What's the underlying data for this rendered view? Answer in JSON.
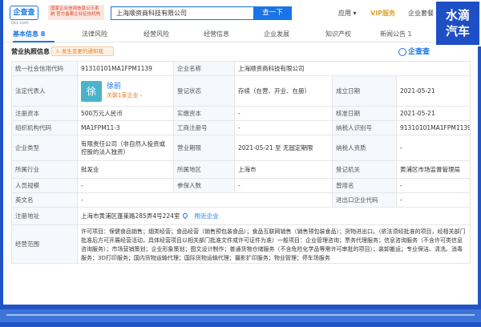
{
  "header": {
    "logo": "企查查",
    "logo_sub": "Qcc.com",
    "promo": "国家企业信用信息公示系统 官方备案企业征信机构",
    "search_value": "上海顺资商科技有限公司",
    "search_button": "查一下",
    "links": [
      "应用 ▾",
      "VIP服务",
      "企业套餐"
    ]
  },
  "corner_logo": [
    "水滴",
    "汽车"
  ],
  "tabs": [
    "基本信息 8",
    "法律风险",
    "经营风险",
    "经营信息",
    "企业发展",
    "知识产权",
    "新闻公告 1"
  ],
  "section": {
    "title": "营业执照信息",
    "warning": "发生变更的通知我",
    "mark": "企查查"
  },
  "table": {
    "credit_code_label": "统一社会信用代码",
    "credit_code": "91310101MA1FPM1139",
    "company_name_label": "企业名称",
    "company_name": "上海顺资商科技有限公司",
    "legal_rep_label": "法定代表人",
    "legal_rep_avatar": "徐",
    "legal_rep_name": "徐前",
    "legal_rep_count": "关联1家企业 ›",
    "reg_status_label": "登记状态",
    "reg_status": "存续（在营、开业、在册）",
    "est_date_label": "成立日期",
    "est_date": "2021-05-21",
    "reg_capital_label": "注册资本",
    "reg_capital": "500万元人民币",
    "paid_capital_label": "实缴资本",
    "paid_capital": "-",
    "approval_date_label": "核准日期",
    "approval_date": "2021-05-21",
    "org_code_label": "组织机构代码",
    "org_code": "MA1FPM11-3",
    "biz_reg_no_label": "工商注册号",
    "biz_reg_no": "-",
    "taxpayer_id_label": "纳税人识别号",
    "taxpayer_id": "91310101MA1FPM1139",
    "company_type_label": "企业类型",
    "company_type": "有限责任公司（非自然人投资或控股的法人独资）",
    "biz_term_label": "营业期限",
    "biz_term": "2021-05-21 至 无固定期限",
    "taxpayer_qual_label": "纳税人资质",
    "taxpayer_qual": "-",
    "industry_label": "所属行业",
    "industry": "批发业",
    "region_label": "所属地区",
    "region": "上海市",
    "reg_authority_label": "登记机关",
    "reg_authority": "黄浦区市场监督管理局",
    "staff_size_label": "人员规模",
    "staff_size": "-",
    "insured_label": "参保人数",
    "insured": "-",
    "former_name_label": "曾用名",
    "former_name": "-",
    "english_name_label": "英文名",
    "english_name": "-",
    "ie_code_label": "进出口企业代码",
    "ie_code": "-",
    "address_label": "注册地址",
    "address": "上海市黄浦区蓬莱路285弄4号224室",
    "nearby": "附近企业",
    "scope_label": "经营范围",
    "scope": "许可项目：保健食品销售；烟类经营；食品经营（销售预包装食品）；食品互联网销售（销售预包装食品）；货物进出口。（依法须经批准的项目，经相关部门批准后方可开展经营活动，具体经营项目以相关部门批准文件或许可证件为准）一般项目：企业管理咨询；票务代理服务；信息咨询服务（不含许可类信息咨询服务）；市场营销策划；企业形象策划；图文设计制作；普通货物仓储服务（不含危险化学品等需许可审批的项目）；装卸搬运；专业保洁、清洗、消毒服务；3D打印服务；国内货物运输代理；国际货物运输代理；摄影扩印服务；物业管理；停车场服务"
  }
}
